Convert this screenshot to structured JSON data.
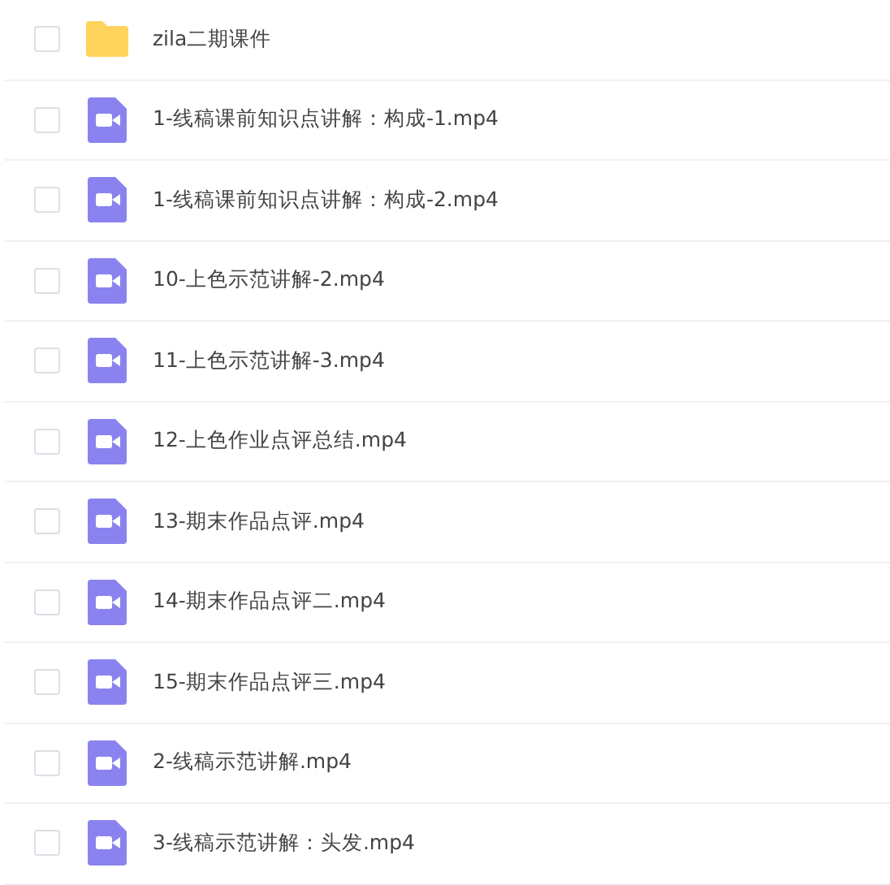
{
  "files": [
    {
      "kind": "folder",
      "name": "zila二期课件",
      "checked": false
    },
    {
      "kind": "video",
      "name": "1-线稿课前知识点讲解：构成-1.mp4",
      "checked": false
    },
    {
      "kind": "video",
      "name": "1-线稿课前知识点讲解：构成-2.mp4",
      "checked": false
    },
    {
      "kind": "video",
      "name": "10-上色示范讲解-2.mp4",
      "checked": false
    },
    {
      "kind": "video",
      "name": "11-上色示范讲解-3.mp4",
      "checked": false
    },
    {
      "kind": "video",
      "name": "12-上色作业点评总结.mp4",
      "checked": false
    },
    {
      "kind": "video",
      "name": "13-期末作品点评.mp4",
      "checked": false
    },
    {
      "kind": "video",
      "name": "14-期末作品点评二.mp4",
      "checked": false
    },
    {
      "kind": "video",
      "name": "15-期末作品点评三.mp4",
      "checked": false
    },
    {
      "kind": "video",
      "name": "2-线稿示范讲解.mp4",
      "checked": false
    },
    {
      "kind": "video",
      "name": "3-线稿示范讲解：头发.mp4",
      "checked": false
    }
  ]
}
